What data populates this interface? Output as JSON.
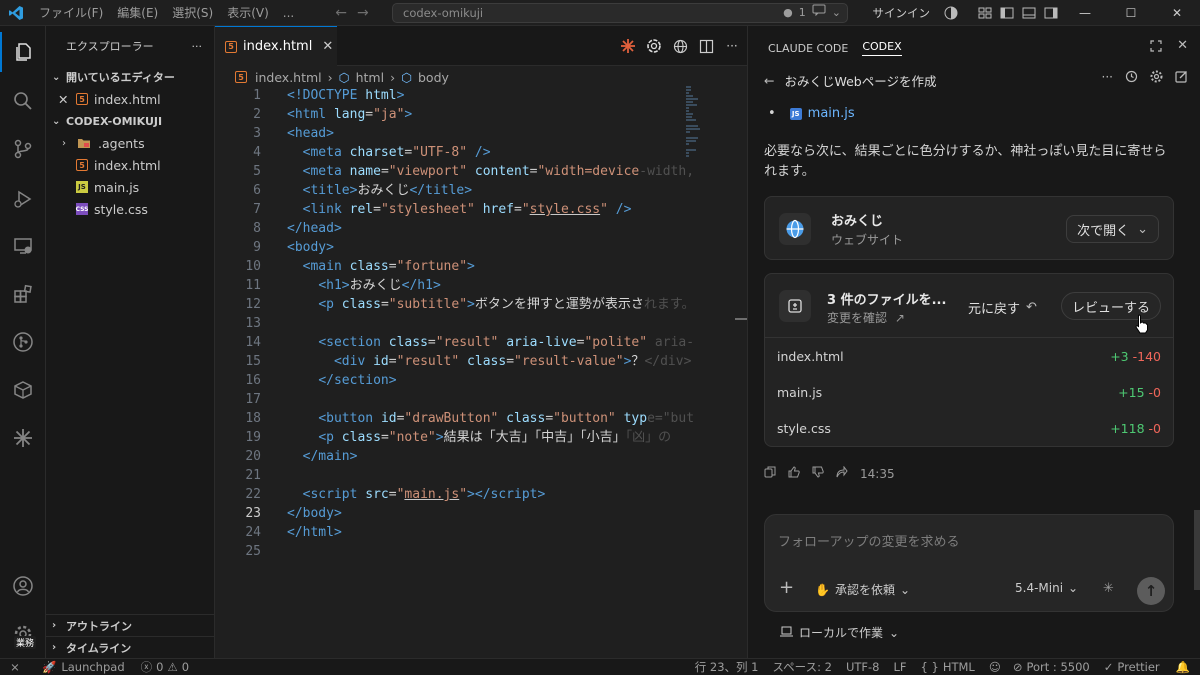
{
  "titlebar": {
    "menus": [
      "ファイル(F)",
      "編集(E)",
      "選択(S)",
      "表示(V)",
      "..."
    ],
    "search": "codex-omikuji",
    "count": "1",
    "signin": "サインイン"
  },
  "sidebar": {
    "title": "エクスプローラー",
    "open_editors": "開いているエディター",
    "open_file": "index.html",
    "project": "CODEX-OMIKUJI",
    "items": [
      ".agents",
      "index.html",
      "main.js",
      "style.css"
    ],
    "outline": "アウトライン",
    "timeline": "タイムライン",
    "work_badge": "業務"
  },
  "editor": {
    "tab": "index.html",
    "crumbs": [
      "index.html",
      "html",
      "body"
    ],
    "current_line": 23
  },
  "code_lines": [
    {
      "n": "1",
      "html": "<span class='tag'>&lt;!DOCTYPE</span> <span class='attr'>html</span><span class='tag'>&gt;</span>"
    },
    {
      "n": "2",
      "html": "<span class='tag'>&lt;html</span> <span class='attr'>lang</span>=<span class='val'>\"ja\"</span><span class='tag'>&gt;</span>"
    },
    {
      "n": "3",
      "html": "<span class='tag'>&lt;head&gt;</span>"
    },
    {
      "n": "4",
      "html": "  <span class='tag'>&lt;meta</span> <span class='attr'>charset</span>=<span class='val'>\"UTF-8\"</span> <span class='tag'>/&gt;</span>"
    },
    {
      "n": "5",
      "html": "  <span class='tag'>&lt;meta</span> <span class='attr'>name</span>=<span class='val'>\"viewport\"</span> <span class='attr'>content</span>=<span class='val'>\"width=device</span><span class='fade'>-width,</span>"
    },
    {
      "n": "6",
      "html": "  <span class='tag'>&lt;title&gt;</span><span class='txt'>おみくじ</span><span class='tag'>&lt;/title&gt;</span>"
    },
    {
      "n": "7",
      "html": "  <span class='tag'>&lt;link</span> <span class='attr'>rel</span>=<span class='val'>\"stylesheet\"</span> <span class='attr'>href</span>=<span class='val'>\"</span><span class='link'>style.css</span><span class='val'>\"</span> <span class='tag'>/&gt;</span>"
    },
    {
      "n": "8",
      "html": "<span class='tag'>&lt;/head&gt;</span>"
    },
    {
      "n": "9",
      "html": "<span class='tag'>&lt;body&gt;</span>"
    },
    {
      "n": "10",
      "html": "  <span class='tag'>&lt;main</span> <span class='attr'>class</span>=<span class='val'>\"fortune\"</span><span class='tag'>&gt;</span>"
    },
    {
      "n": "11",
      "html": "    <span class='tag'>&lt;h1&gt;</span><span class='txt'>おみくじ</span><span class='tag'>&lt;/h1&gt;</span>"
    },
    {
      "n": "12",
      "html": "    <span class='tag'>&lt;p</span> <span class='attr'>class</span>=<span class='val'>\"subtitle\"</span><span class='tag'>&gt;</span><span class='txt'>ボタンを押すと運勢が表示さ</span><span class='fade'>れます。</span>"
    },
    {
      "n": "13",
      "html": ""
    },
    {
      "n": "14",
      "html": "    <span class='tag'>&lt;section</span> <span class='attr'>class</span>=<span class='val'>\"result\"</span> <span class='attr'>aria-live</span>=<span class='val'>\"polite\"</span> <span class='fade'>aria-</span>"
    },
    {
      "n": "15",
      "html": "      <span class='tag'>&lt;div</span> <span class='attr'>id</span>=<span class='val'>\"result\"</span> <span class='attr'>class</span>=<span class='val'>\"result-value\"</span><span class='tag'>&gt;</span><span class='txt'>？</span><span class='fade'>&lt;/div&gt;</span>"
    },
    {
      "n": "16",
      "html": "    <span class='tag'>&lt;/section&gt;</span>"
    },
    {
      "n": "17",
      "html": ""
    },
    {
      "n": "18",
      "html": "    <span class='tag'>&lt;button</span> <span class='attr'>id</span>=<span class='val'>\"drawButton\"</span> <span class='attr'>class</span>=<span class='val'>\"button\"</span> <span class='attr'>typ</span><span class='fade'>e=\"but</span>"
    },
    {
      "n": "19",
      "html": "    <span class='tag'>&lt;p</span> <span class='attr'>class</span>=<span class='val'>\"note\"</span><span class='tag'>&gt;</span><span class='txt'>結果は「大吉」「中吉」「小吉」</span><span class='fade'>「凶」の</span>"
    },
    {
      "n": "20",
      "html": "  <span class='tag'>&lt;/main&gt;</span>"
    },
    {
      "n": "21",
      "html": ""
    },
    {
      "n": "22",
      "html": "  <span class='tag'>&lt;script</span> <span class='attr'>src</span>=<span class='val'>\"</span><span class='link'>main.js</span><span class='val'>\"</span><span class='tag'>&gt;&lt;/script&gt;</span>"
    },
    {
      "n": "23",
      "html": "<span class='tag'>&lt;/body&gt;</span>"
    },
    {
      "n": "24",
      "html": "<span class='tag'>&lt;/html&gt;</span>"
    },
    {
      "n": "25",
      "html": ""
    }
  ],
  "panel": {
    "tabs": [
      "CLAUDE CODE",
      "CODEX"
    ],
    "task_title": "おみくじWebページを作成",
    "bullet_file": "main.js",
    "message": "必要なら次に、結果ごとに色分けするか、神社っぽい見た目に寄せられます。",
    "site_card": {
      "title": "おみくじ",
      "subtitle": "ウェブサイト",
      "open_label": "次で開く"
    },
    "changes_card": {
      "title": "3 件のファイルを...",
      "subtitle": "変更を確認",
      "revert_label": "元に戻す",
      "review_label": "レビューする",
      "files": [
        {
          "name": "index.html",
          "added": "+3",
          "removed": "-140"
        },
        {
          "name": "main.js",
          "added": "+15",
          "removed": "-0"
        },
        {
          "name": "style.css",
          "added": "+118",
          "removed": "-0"
        }
      ]
    },
    "time": "14:35",
    "input_placeholder": "フォローアップの変更を求める",
    "approval_label": "承認を依頼",
    "model_label": "5.4-Mini",
    "local_label": "ローカルで作業"
  },
  "statusbar": {
    "launchpad": "Launchpad",
    "errors": "0",
    "warnings": "0",
    "position": "行 23、列 1",
    "spaces": "スペース: 2",
    "encoding": "UTF-8",
    "eol": "LF",
    "language": "HTML",
    "port": "Port : 5500",
    "prettier": "Prettier"
  },
  "colors": {
    "accent": "#0078d4",
    "added": "#4ec973",
    "removed": "#f0665a",
    "link": "#6cb6ff"
  }
}
